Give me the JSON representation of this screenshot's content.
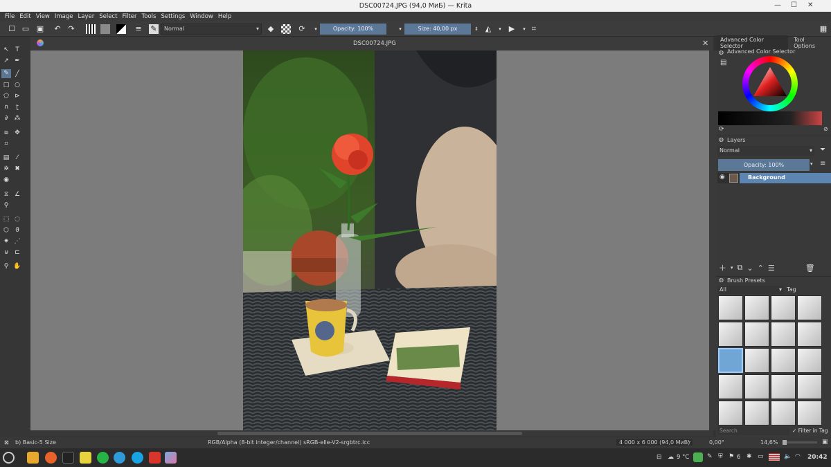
{
  "window": {
    "title": "DSC00724.JPG (94,0 МиБ) — Krita",
    "minimize": "—",
    "maximize": "☐",
    "close": "✕"
  },
  "menu": [
    "File",
    "Edit",
    "View",
    "Image",
    "Layer",
    "Select",
    "Filter",
    "Tools",
    "Settings",
    "Window",
    "Help"
  ],
  "toolbar": {
    "blend_mode": "Normal",
    "opacity": "Opacity: 100%",
    "size": "Size: 40,00 px"
  },
  "document": {
    "tab_title": "DSC00724.JPG",
    "close": "✕"
  },
  "dock_tabs": [
    "Advanced Color Selector",
    "Tool Options"
  ],
  "color_selector": {
    "title": "Advanced Color Selector"
  },
  "layers": {
    "title": "Layers",
    "blend_mode": "Normal",
    "opacity": "Opacity: 100%",
    "items": [
      {
        "name": "Background",
        "selected": true
      }
    ]
  },
  "brush_presets": {
    "title": "Brush Presets",
    "filter": "All",
    "tag": "Tag",
    "search_placeholder": "Search",
    "filter_in_tag": "Filter in Tag"
  },
  "status": {
    "brush": "b) Basic-5 Size",
    "colorspace": "RGB/Alpha (8-bit integer/channel)  sRGB-elle-V2-srgbtrc.icc",
    "dimensions": "4 000 x 6 000 (94,0 МиБ)",
    "rotation": "0,00°",
    "zoom": "14,6%"
  },
  "taskbar": {
    "weather": "9 °C",
    "count": "6",
    "time": "20:42"
  },
  "colors": {
    "accent": "#5b7896",
    "layer_selected": "#5d85b2",
    "canvas_bg": "#7c7c7c"
  }
}
